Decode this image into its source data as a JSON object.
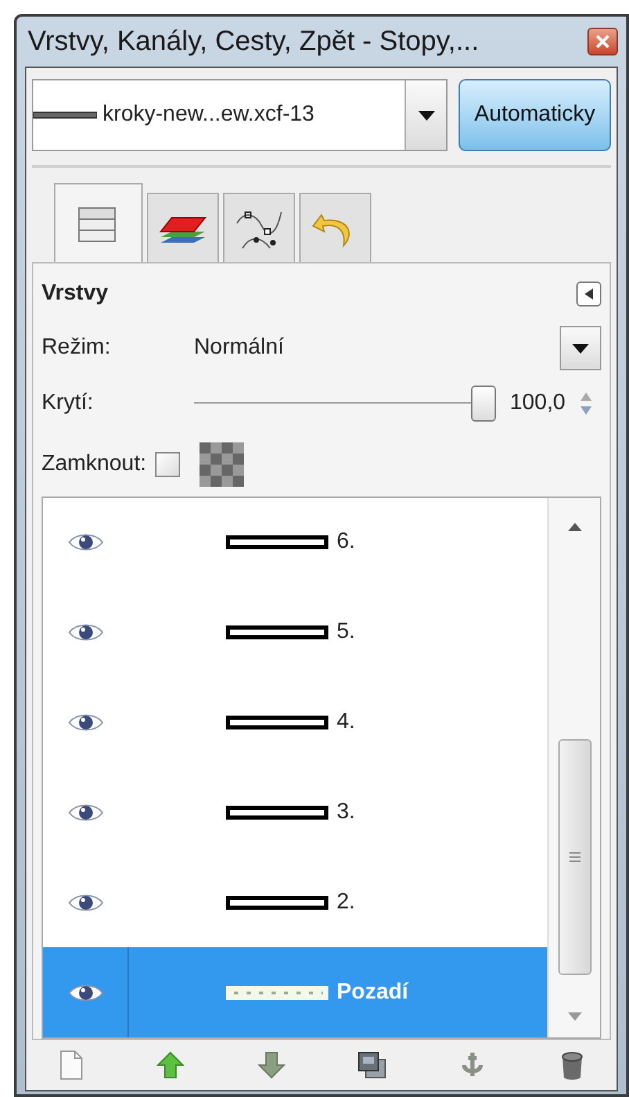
{
  "window": {
    "title": "Vrstvy, Kanály, Cesty, Zpět - Stopy,..."
  },
  "image_combo": {
    "value": "kroky-new...ew.xcf-13"
  },
  "auto_button": {
    "label": "Automaticky"
  },
  "tabs": [
    {
      "kind": "layers",
      "selected": true
    },
    {
      "kind": "channels",
      "selected": false
    },
    {
      "kind": "paths",
      "selected": false
    },
    {
      "kind": "undo",
      "selected": false
    }
  ],
  "panel": {
    "title": "Vrstvy",
    "mode_label": "Režim:",
    "mode_value": "Normální",
    "opacity_label": "Krytí:",
    "opacity": {
      "level": 1
    },
    "opacity_value": "100,0",
    "lock_label": "Zamknout:",
    "lock_pixels": {
      "checked": false
    }
  },
  "layers": [
    {
      "name": "6.",
      "kind": "line",
      "visible": true,
      "selected": false
    },
    {
      "name": "5.",
      "kind": "line",
      "visible": true,
      "selected": false
    },
    {
      "name": "4.",
      "kind": "line",
      "visible": true,
      "selected": false
    },
    {
      "name": "3.",
      "kind": "line",
      "visible": true,
      "selected": false
    },
    {
      "name": "2.",
      "kind": "line",
      "visible": true,
      "selected": false
    },
    {
      "name": "Pozadí",
      "kind": "background",
      "visible": true,
      "selected": true
    }
  ],
  "toolbar": [
    {
      "kind": "new"
    },
    {
      "kind": "raise"
    },
    {
      "kind": "lower"
    },
    {
      "kind": "duplicate"
    },
    {
      "kind": "anchor"
    },
    {
      "kind": "delete"
    }
  ]
}
